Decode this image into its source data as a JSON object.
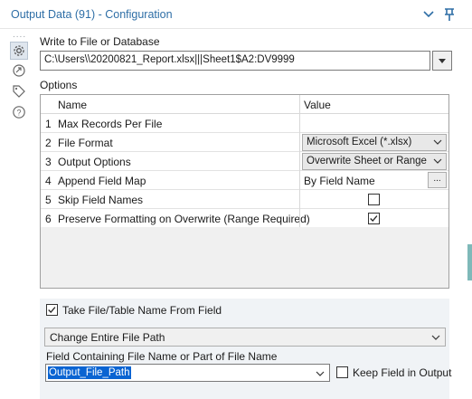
{
  "window": {
    "title": "Output Data (91) - Configuration",
    "collapse_icon": "chevron-down-icon",
    "pin_icon": "pin-icon"
  },
  "sidebar": {
    "dots": "....",
    "items": [
      {
        "name": "configuration",
        "icon": "gear-icon",
        "active": true
      },
      {
        "name": "annotation",
        "icon": "annotation-arrow-icon",
        "active": false
      },
      {
        "name": "tag",
        "icon": "tag-icon",
        "active": false
      },
      {
        "name": "help",
        "icon": "help-icon",
        "active": false
      }
    ]
  },
  "write_section": {
    "label": "Write to File or Database",
    "path_value": "C:\\Users\\\\20200821_Report.xlsx|||Sheet1$A2:DV9999"
  },
  "options": {
    "label": "Options",
    "columns": [
      "Name",
      "Value"
    ],
    "rows": [
      {
        "num": "1",
        "name": "Max Records Per File",
        "value": "",
        "kind": "text"
      },
      {
        "num": "2",
        "name": "File Format",
        "value": "Microsoft Excel (*.xlsx)",
        "kind": "select"
      },
      {
        "num": "3",
        "name": "Output Options",
        "value": "Overwrite Sheet or Range",
        "kind": "select"
      },
      {
        "num": "4",
        "name": "Append Field Map",
        "value": "By Field Name",
        "kind": "ellipsis",
        "button": "..."
      },
      {
        "num": "5",
        "name": "Skip Field Names",
        "value": "",
        "kind": "checkbox",
        "checked": false
      },
      {
        "num": "6",
        "name": "Preserve Formatting on Overwrite (Range Required)",
        "value": "",
        "kind": "checkbox",
        "checked": true
      }
    ]
  },
  "bottom": {
    "take_name_label": "Take File/Table Name From Field",
    "take_name_checked": true,
    "mode_value": "Change Entire File Path",
    "field_label": "Field Containing File Name or Part of File Name",
    "field_value": "Output_File_Path",
    "keep_field_label": "Keep Field in Output",
    "keep_field_checked": false
  },
  "colors": {
    "title": "#2e6ea6",
    "selection": "#0a64d2",
    "panel": "#f0f3f6"
  }
}
